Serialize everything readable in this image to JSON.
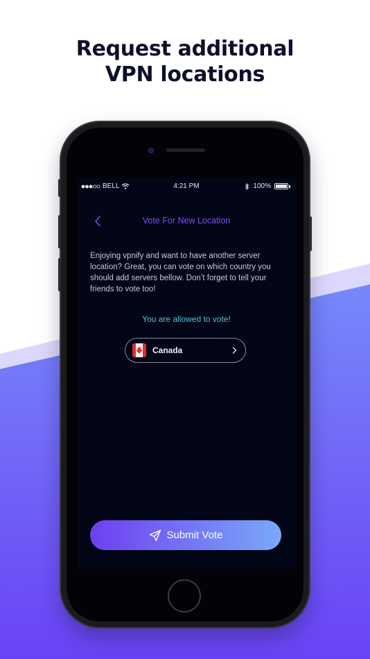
{
  "headline": {
    "line1": "Request additional",
    "line2": "VPN locations"
  },
  "status_bar": {
    "carrier": "BELL",
    "time": "4:21 PM",
    "battery": "100%"
  },
  "nav": {
    "title": "Vote For New Location",
    "back_icon": "chevron-left-icon"
  },
  "content": {
    "description": "Enjoying vpnify and want to have another server location? Great, you can vote on which country you should add servers bellow. Don’t forget to tell your friends to vote too!",
    "vote_status": "You are allowed to vote!",
    "selected_country": "Canada"
  },
  "submit": {
    "label": "Submit Vote",
    "icon": "send-icon"
  },
  "colors": {
    "accent": "#7b52f0",
    "status_text": "#4fc6d8",
    "button_gradient_start": "#6f3ff0",
    "button_gradient_end": "#79a9f9",
    "screen_bg": "#020617",
    "background_gradient_start": "#7788fa",
    "background_gradient_end": "#6a42f5"
  }
}
